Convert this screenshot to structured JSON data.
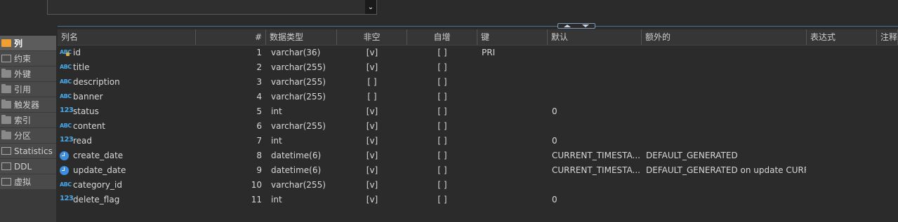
{
  "top_dropdown": {
    "arrow": "⌄"
  },
  "sidebar": {
    "items": [
      {
        "label": "列",
        "icon": "list-icon",
        "active": true
      },
      {
        "label": "约束",
        "icon": "constraint-icon"
      },
      {
        "label": "外键",
        "icon": "folder-icon"
      },
      {
        "label": "引用",
        "icon": "folder-icon"
      },
      {
        "label": "触发器",
        "icon": "folder-icon"
      },
      {
        "label": "索引",
        "icon": "folder-icon"
      },
      {
        "label": "分区",
        "icon": "folder-icon"
      },
      {
        "label": "Statistics",
        "icon": "info-icon"
      },
      {
        "label": "DDL",
        "icon": "ddl-icon"
      },
      {
        "label": "虚拟",
        "icon": "virtual-icon"
      }
    ]
  },
  "table": {
    "headers": [
      "列名",
      "#",
      "数据类型",
      "非空",
      "自增",
      "键",
      "默认",
      "额外的",
      "表达式",
      "注释"
    ],
    "rows": [
      {
        "type_icon": "ABC",
        "name": "id",
        "num": "1",
        "dtype": "varchar(36)",
        "notnull": "[v]",
        "autoinc": "[ ]",
        "key": "PRI",
        "default": "",
        "extra": "",
        "is_key": true
      },
      {
        "type_icon": "ABC",
        "name": "title",
        "num": "2",
        "dtype": "varchar(255)",
        "notnull": "[v]",
        "autoinc": "[ ]",
        "key": "",
        "default": "",
        "extra": ""
      },
      {
        "type_icon": "ABC",
        "name": "description",
        "num": "3",
        "dtype": "varchar(255)",
        "notnull": "[ ]",
        "autoinc": "[ ]",
        "key": "",
        "default": "",
        "extra": ""
      },
      {
        "type_icon": "ABC",
        "name": "banner",
        "num": "4",
        "dtype": "varchar(255)",
        "notnull": "[ ]",
        "autoinc": "[ ]",
        "key": "",
        "default": "",
        "extra": ""
      },
      {
        "type_icon": "123",
        "name": "status",
        "num": "5",
        "dtype": "int",
        "notnull": "[v]",
        "autoinc": "[ ]",
        "key": "",
        "default": "0",
        "extra": ""
      },
      {
        "type_icon": "ABC",
        "name": "content",
        "num": "6",
        "dtype": "varchar(255)",
        "notnull": "[v]",
        "autoinc": "[ ]",
        "key": "",
        "default": "",
        "extra": ""
      },
      {
        "type_icon": "123",
        "name": "read",
        "num": "7",
        "dtype": "int",
        "notnull": "[v]",
        "autoinc": "[ ]",
        "key": "",
        "default": "0",
        "extra": ""
      },
      {
        "type_icon": "clock",
        "name": "create_date",
        "num": "8",
        "dtype": "datetime(6)",
        "notnull": "[v]",
        "autoinc": "[ ]",
        "key": "",
        "default": "CURRENT_TIMESTA...",
        "extra": "DEFAULT_GENERATED"
      },
      {
        "type_icon": "clock",
        "name": "update_date",
        "num": "9",
        "dtype": "datetime(6)",
        "notnull": "[v]",
        "autoinc": "[ ]",
        "key": "",
        "default": "CURRENT_TIMESTA...",
        "extra": "DEFAULT_GENERATED on update CURRE..."
      },
      {
        "type_icon": "ABC",
        "name": "category_id",
        "num": "10",
        "dtype": "varchar(255)",
        "notnull": "[v]",
        "autoinc": "[ ]",
        "key": "",
        "default": "",
        "extra": ""
      },
      {
        "type_icon": "123",
        "name": "delete_flag",
        "num": "11",
        "dtype": "int",
        "notnull": "[v]",
        "autoinc": "[ ]",
        "key": "",
        "default": "0",
        "extra": ""
      }
    ]
  }
}
